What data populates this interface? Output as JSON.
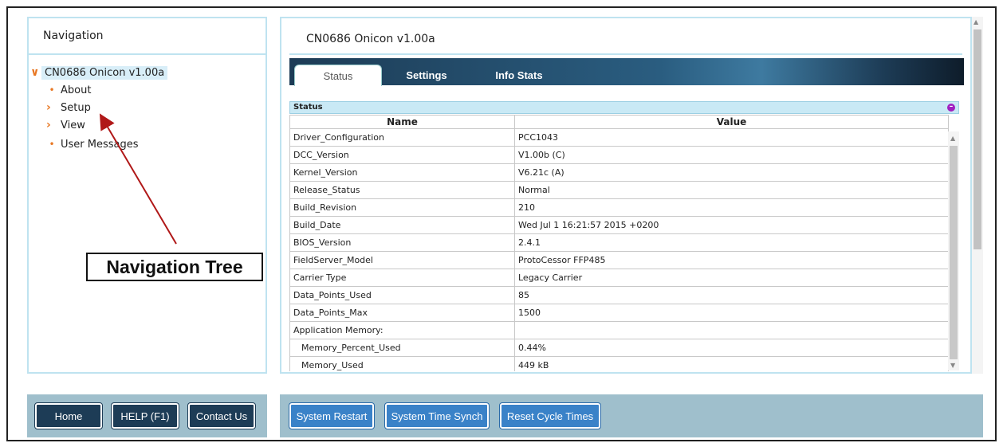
{
  "navigation": {
    "title": "Navigation",
    "tree": {
      "root_label": "CN0686 Onicon v1.00a",
      "items": [
        {
          "label": "About",
          "icon": "bullet-icon"
        },
        {
          "label": "Setup",
          "icon": "chevron-right-icon"
        },
        {
          "label": "View",
          "icon": "chevron-right-icon"
        },
        {
          "label": "User Messages",
          "icon": "bullet-icon"
        }
      ]
    }
  },
  "annotation": {
    "label": "Navigation Tree"
  },
  "main": {
    "title": "CN0686 Onicon v1.00a",
    "tabs": [
      {
        "label": "Status"
      },
      {
        "label": "Settings"
      },
      {
        "label": "Info Stats"
      }
    ],
    "status_section": {
      "header": "Status",
      "columns": [
        "Name",
        "Value"
      ],
      "rows": [
        {
          "name": "Driver_Configuration",
          "value": "PCC1043"
        },
        {
          "name": "DCC_Version",
          "value": "V1.00b (C)"
        },
        {
          "name": "Kernel_Version",
          "value": "V6.21c (A)"
        },
        {
          "name": "Release_Status",
          "value": "Normal"
        },
        {
          "name": "Build_Revision",
          "value": "210"
        },
        {
          "name": "Build_Date",
          "value": "Wed Jul 1 16:21:57 2015 +0200"
        },
        {
          "name": "BIOS_Version",
          "value": "2.4.1"
        },
        {
          "name": "FieldServer_Model",
          "value": "ProtoCessor FFP485"
        },
        {
          "name": "Carrier Type",
          "value": "Legacy Carrier"
        },
        {
          "name": "Data_Points_Used",
          "value": "85"
        },
        {
          "name": "Data_Points_Max",
          "value": "1500"
        },
        {
          "name": "Application Memory:",
          "value": ""
        },
        {
          "name": "Memory_Percent_Used",
          "value": "0.44%"
        },
        {
          "name": "Memory_Used",
          "value": "449 kB"
        }
      ]
    }
  },
  "footer": {
    "left_buttons": [
      {
        "label": "Home"
      },
      {
        "label": "HELP (F1)"
      },
      {
        "label": "Contact Us"
      }
    ],
    "right_buttons": [
      {
        "label": "System Restart"
      },
      {
        "label": "System Time Synch"
      },
      {
        "label": "Reset Cycle Times"
      }
    ]
  },
  "colors": {
    "accent_orange": "#e87722",
    "panel_border": "#bfe3f0",
    "tab_bar_dark": "#1d3c56",
    "footer_bg": "#9fbfcc",
    "action_button_blue": "#3a82c8"
  }
}
